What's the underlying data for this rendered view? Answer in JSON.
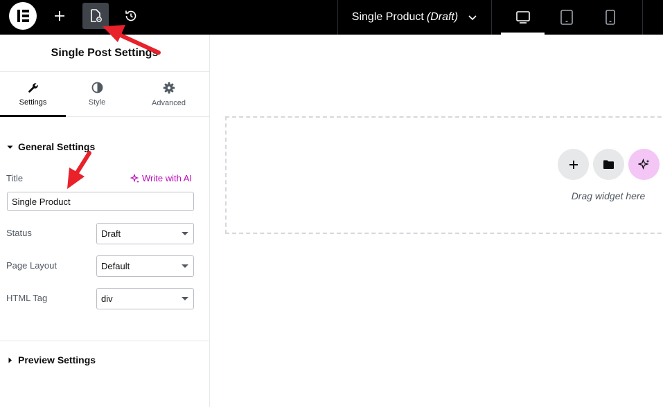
{
  "topbar": {
    "document_title": "Single Product",
    "document_status": "(Draft)",
    "icons": {
      "logo": "elementor-logo",
      "add": "plus-icon",
      "page_settings": "page-settings-icon",
      "history": "history-icon",
      "title_dropdown": "chevron-down-icon",
      "desktop": "desktop-icon",
      "tablet": "tablet-icon",
      "mobile": "mobile-icon"
    }
  },
  "panel": {
    "header_title": "Single Post Settings",
    "tabs": [
      {
        "label": "Settings",
        "icon": "wrench-icon"
      },
      {
        "label": "Style",
        "icon": "half-circle-icon"
      },
      {
        "label": "Advanced",
        "icon": "gear-icon"
      }
    ],
    "general_section": {
      "title": "General Settings",
      "title_label": "Title",
      "ai_link": "Write with AI",
      "title_value": "Single Product",
      "status_label": "Status",
      "status_value": "Draft",
      "layout_label": "Page Layout",
      "layout_value": "Default",
      "html_tag_label": "HTML Tag",
      "html_tag_value": "div"
    },
    "preview_section": {
      "title": "Preview Settings"
    }
  },
  "canvas": {
    "drag_text": "Drag widget here",
    "colors": {
      "ai_button": "#f3c6f5",
      "neutral_button": "#e6e8ea",
      "annotation_arrow": "#e8212b"
    }
  }
}
